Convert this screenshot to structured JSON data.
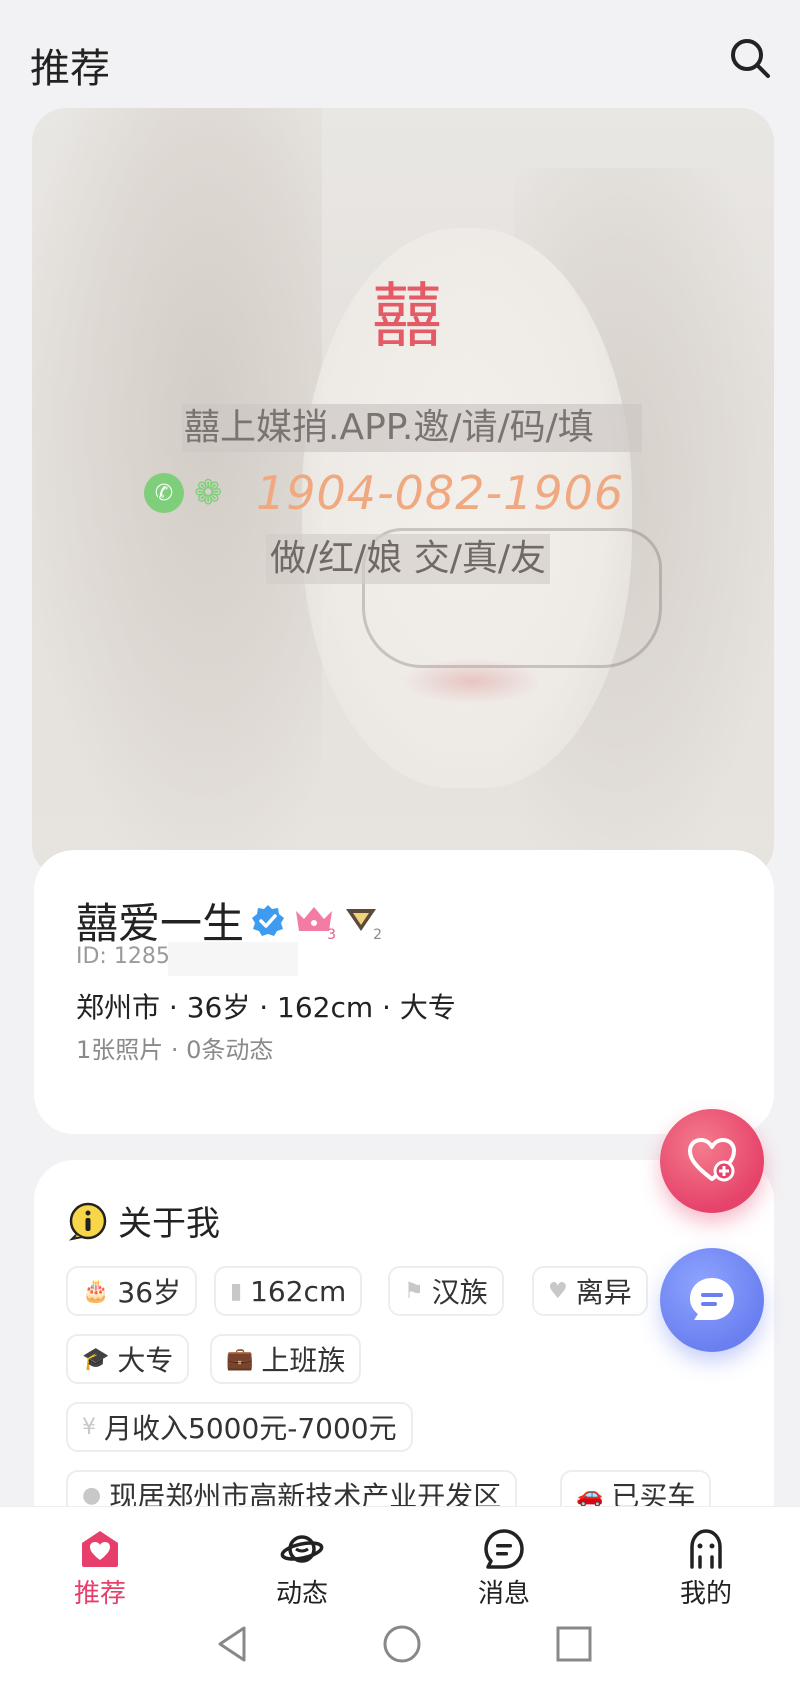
{
  "header": {
    "title": "推荐"
  },
  "photo": {
    "logo_text": "囍",
    "watermark_line1": "囍上媒捎.APP.邀/请/码/填",
    "watermark_phone": "1904-082-1906",
    "watermark_line3": "做/红/娘 交/真/友"
  },
  "profile": {
    "name": "囍爱一生",
    "id": "ID: 1285",
    "crown_level": "3",
    "diamond_level": "2",
    "basic": "郑州市 · 36岁 · 162cm · 大专",
    "stats": "1张照片 · 0条动态"
  },
  "about": {
    "title": "关于我",
    "tags": [
      {
        "icon": "cake-icon",
        "label": "36岁"
      },
      {
        "icon": "height-icon",
        "label": "162cm"
      },
      {
        "icon": "flag-icon",
        "label": "汉族"
      },
      {
        "icon": "heart-icon",
        "label": "离异"
      },
      {
        "icon": "graduation-cap-icon",
        "label": "大专"
      },
      {
        "icon": "briefcase-icon",
        "label": "上班族"
      },
      {
        "icon": "yen-icon",
        "label": "月收入5000元-7000元"
      },
      {
        "icon": "location-pin-icon",
        "label": "现居郑州市高新技术产业开发区"
      },
      {
        "icon": "car-icon",
        "label": "已买车"
      }
    ]
  },
  "tabbar": {
    "items": [
      {
        "label": "推荐",
        "icon": "heart-home-icon",
        "active": true
      },
      {
        "label": "动态",
        "icon": "planet-icon",
        "active": false
      },
      {
        "label": "消息",
        "icon": "message-icon",
        "active": false
      },
      {
        "label": "我的",
        "icon": "profile-icon",
        "active": false
      }
    ]
  },
  "colors": {
    "accent": "#e83e6c",
    "chat": "#6b80f0",
    "verified": "#3d9bf0"
  }
}
